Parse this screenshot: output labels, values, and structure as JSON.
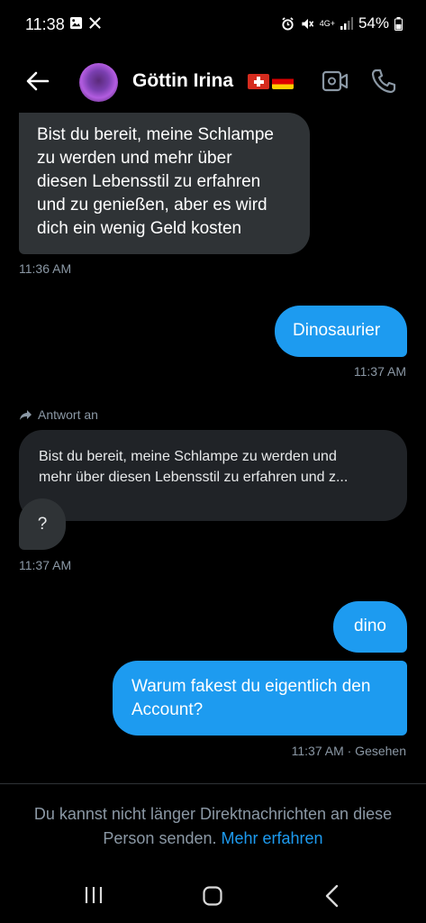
{
  "status_bar": {
    "time": "11:38",
    "network": "4G+",
    "battery": "54%",
    "left_icons": [
      "gallery-icon",
      "x-logo-icon"
    ],
    "right_icons": [
      "alarm-icon",
      "mute-icon",
      "signal-icon",
      "battery-icon"
    ]
  },
  "header": {
    "contact_name": "Göttin Irina",
    "flags": [
      "swiss-flag",
      "german-flag"
    ],
    "icons": [
      "back-arrow-icon",
      "video-call-icon",
      "phone-icon"
    ]
  },
  "messages": [
    {
      "direction": "incoming",
      "text": "Bist du bereit, meine Schlampe zu werden und mehr über diesen Lebensstil zu erfahren und zu genießen, aber es wird dich ein wenig Geld kosten",
      "lines": [
        "Bist du bereit, meine Schlampe",
        "zu werden und mehr über",
        "diesen Lebensstil zu erfahren",
        "und zu genießen, aber es wird",
        "dich ein wenig Geld kosten"
      ],
      "time": "11:36 AM"
    },
    {
      "direction": "outgoing",
      "text": "Dinosaurier",
      "time": "11:37 AM"
    },
    {
      "direction": "incoming",
      "reply_label": "Antwort an",
      "quoted_lines": [
        "Bist du bereit, meine Schlampe zu werden und",
        "mehr über diesen Lebensstil zu erfahren und z..."
      ],
      "text": "?",
      "time": "11:37 AM"
    },
    {
      "direction": "outgoing",
      "text": "dino"
    },
    {
      "direction": "outgoing",
      "text": "Warum fakest du eigentlich den Account?",
      "lines": [
        "Warum fakest du eigentlich den",
        "Account?"
      ],
      "time": "11:37 AM · Gesehen"
    }
  ],
  "notice": {
    "text": "Du kannst nicht länger Direktnachrichten an diese Person senden.",
    "link": "Mehr erfahren"
  },
  "colors": {
    "background": "#000000",
    "incoming_bubble": "#2f3336",
    "outgoing_bubble": "#1d9bf0",
    "secondary_text": "#8b98a5",
    "link": "#1d9bf0"
  }
}
